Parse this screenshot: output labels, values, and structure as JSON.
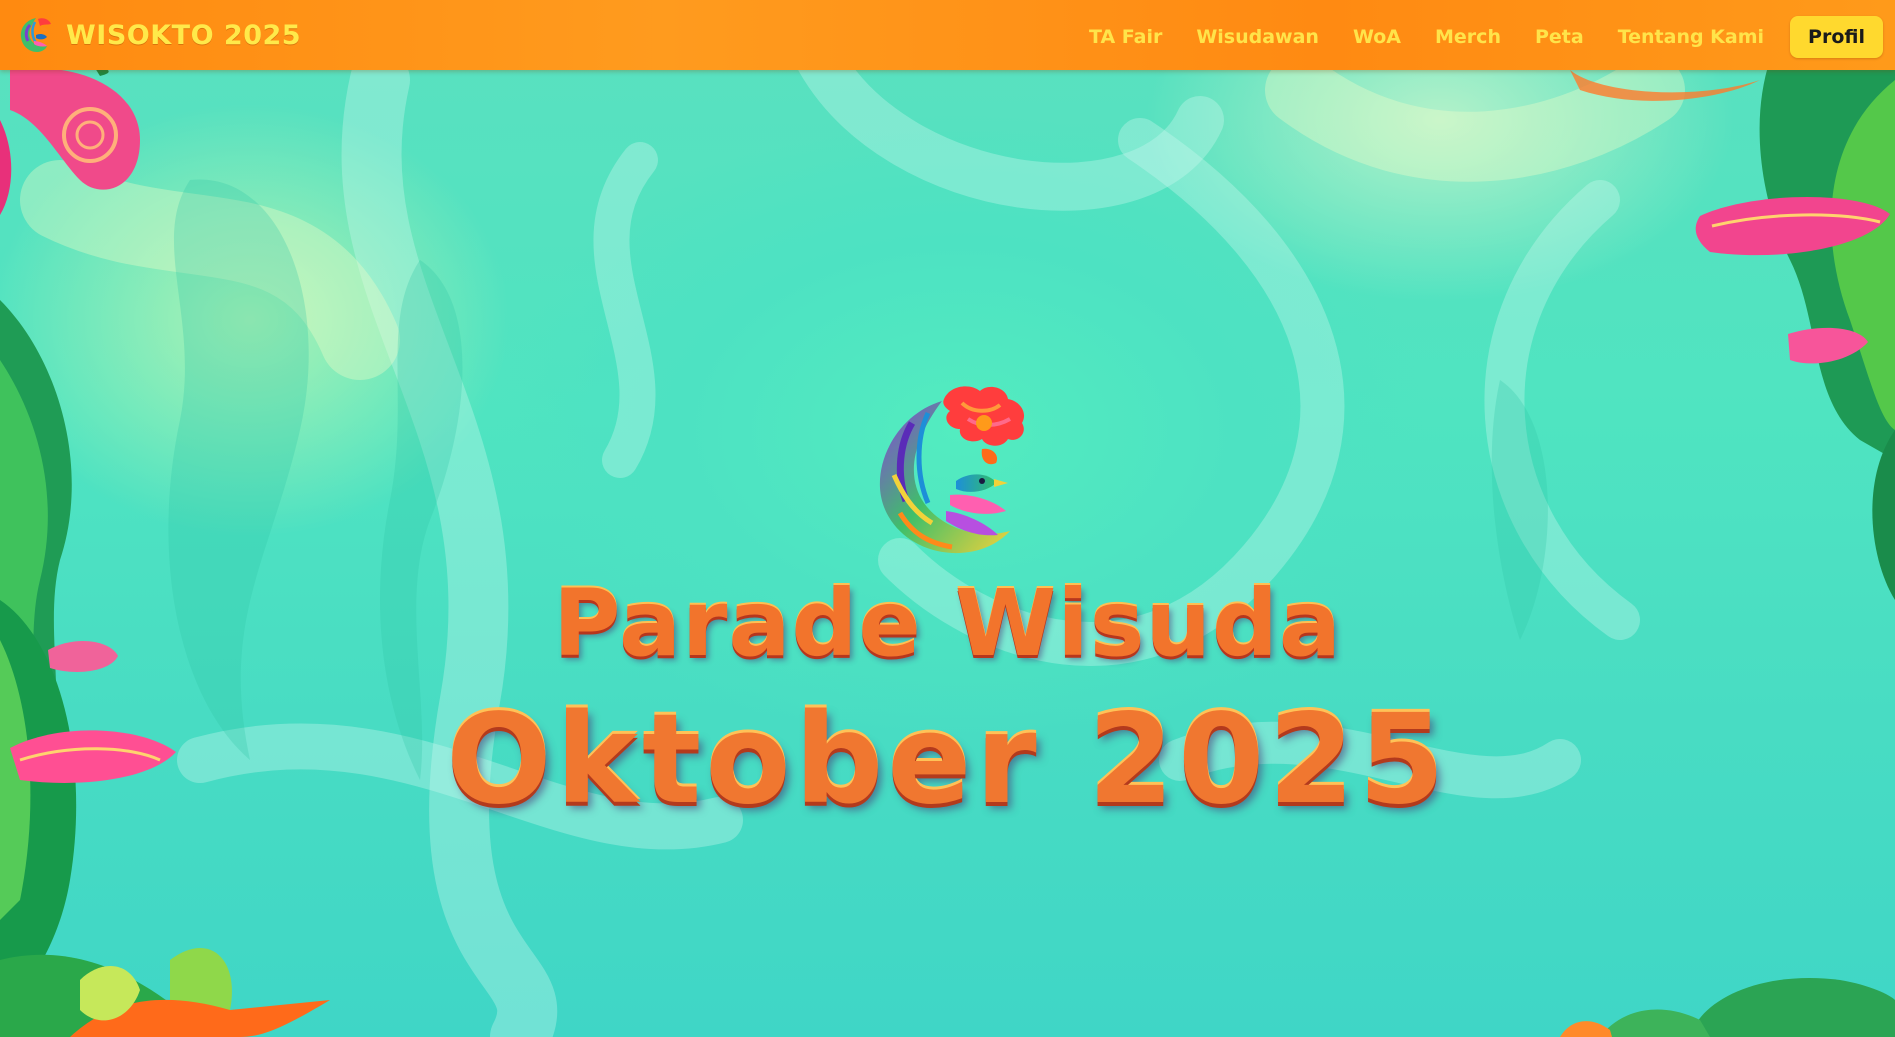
{
  "header": {
    "brand": {
      "name": "WISOKTO 2025",
      "logo_icon": "rooster-emblem-icon"
    },
    "nav": {
      "items": [
        {
          "label": "TA Fair"
        },
        {
          "label": "Wisudawan"
        },
        {
          "label": "WoA"
        },
        {
          "label": "Merch"
        },
        {
          "label": "Peta"
        },
        {
          "label": "Tentang Kami"
        }
      ],
      "profile_button": "Profil"
    }
  },
  "hero": {
    "emblem_icon": "rooster-emblem-icon",
    "title_line_1": "Parade Wisuda",
    "title_line_2": "Oktober 2025"
  },
  "colors": {
    "header_bg": "#ff8f15",
    "nav_text": "#ffe44a",
    "profile_button_bg": "#ffd92e",
    "background": "#4fe4c1",
    "title_orange": "#f2742c"
  }
}
